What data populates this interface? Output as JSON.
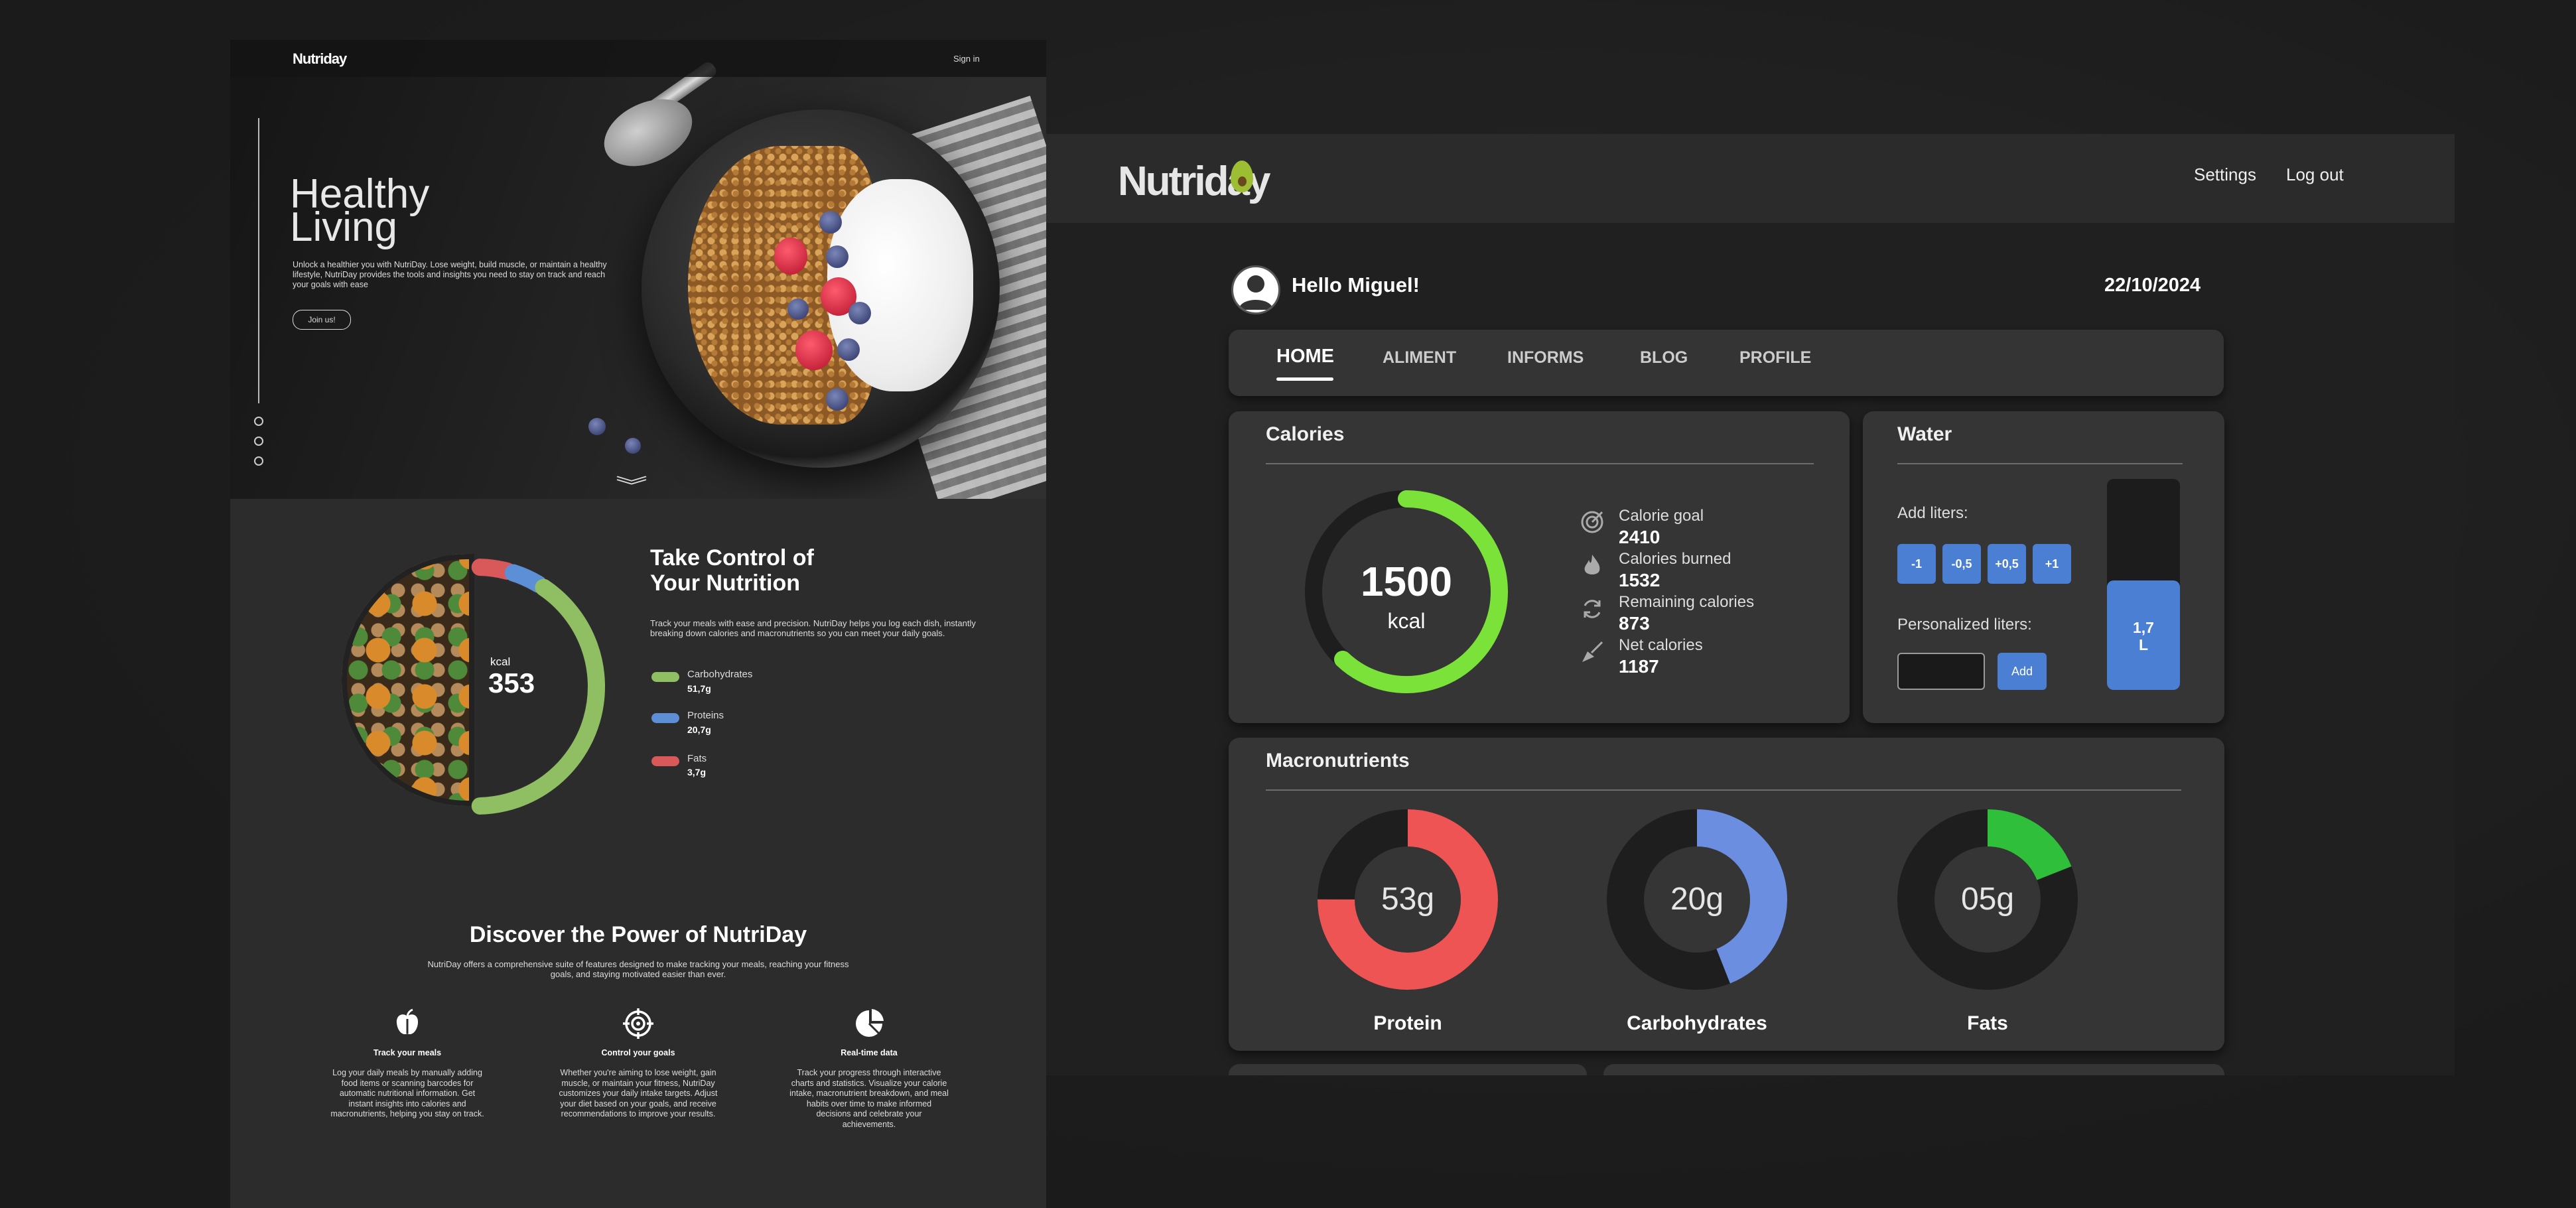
{
  "landing": {
    "nav": {
      "logo": "Nutriday",
      "signin": "Sign in"
    },
    "hero": {
      "title_line1": "Healthy",
      "title_line2": "Living",
      "text": "Unlock a healthier you with NutriDay. Lose weight, build muscle, or maintain a healthy lifestyle, NutriDay provides the tools and insights you need to stay on track and reach your goals with ease",
      "cta": "Join us!",
      "scroll_icon": "chevron-down-icon"
    },
    "nutrition": {
      "title_line1": "Take Control of",
      "title_line2": "Your Nutrition",
      "text": "Track your meals with ease and precision. NutriDay helps you log each dish, instantly breaking down calories and macronutrients so you can meet your daily goals.",
      "kcal_label": "kcal",
      "kcal_value": "353",
      "legend": [
        {
          "name": "Carbohydrates",
          "value": "51,7g",
          "color": "#8fbf62"
        },
        {
          "name": "Proteins",
          "value": "20,7g",
          "color": "#5d8fd6"
        },
        {
          "name": "Fats",
          "value": "3,7g",
          "color": "#d9585a"
        }
      ],
      "ring_fractions": {
        "red": 0.09,
        "blue": 0.09,
        "green": 0.82
      }
    },
    "discover": {
      "title": "Discover the Power of NutriDay",
      "text": "NutriDay offers a comprehensive suite of features designed to make tracking your meals, reaching your fitness goals, and staying motivated easier than ever.",
      "features": [
        {
          "icon": "apple-icon",
          "title": "Track your meals",
          "text": "Log your daily meals by manually adding food items or scanning barcodes for automatic nutritional information. Get instant insights into calories and macronutrients, helping you stay on track."
        },
        {
          "icon": "target-icon",
          "title": "Control your goals",
          "text": "Whether you're aiming to lose weight, gain muscle, or maintain your fitness, NutriDay customizes your daily intake targets. Adjust your diet based on your goals, and receive recommendations to improve your results."
        },
        {
          "icon": "pie-chart-icon",
          "title": "Real-time data",
          "text": "Track your progress through interactive charts and statistics. Visualize your calorie intake, macronutrient breakdown, and meal habits over time to make informed decisions and celebrate your achievements."
        }
      ]
    }
  },
  "dashboard": {
    "logo": "Nutriday",
    "nav": {
      "settings": "Settings",
      "logout": "Log out"
    },
    "greeting": "Hello Miguel!",
    "date": "22/10/2024",
    "tabs": [
      "HOME",
      "ALIMENT",
      "INFORMS",
      "BLOG",
      "PROFILE"
    ],
    "calories": {
      "title": "Calories",
      "center_value": "1500",
      "center_unit": "kcal",
      "progress_fraction": 0.62,
      "stats": [
        {
          "icon": "target-icon",
          "label": "Calorie goal",
          "value": "2410"
        },
        {
          "icon": "flame-icon",
          "label": "Calories burned",
          "value": "1532"
        },
        {
          "icon": "refresh-icon",
          "label": "Remaining calories",
          "value": "873"
        },
        {
          "icon": "broom-icon",
          "label": "Net calories",
          "value": "1187"
        }
      ]
    },
    "water": {
      "title": "Water",
      "add_label": "Add liters:",
      "buttons": [
        "-1",
        "-0,5",
        "+0,5",
        "+1"
      ],
      "personalized_label": "Personalized liters:",
      "input_value": "",
      "add_button": "Add",
      "bottle_line1": "1,7",
      "bottle_line2": "L",
      "fill_fraction": 0.52
    },
    "macros": {
      "title": "Macronutrients",
      "items": [
        {
          "value": "53g",
          "label": "Protein",
          "fraction": 0.75,
          "color": "#ef5454"
        },
        {
          "value": "20g",
          "label": "Carbohydrates",
          "fraction": 0.44,
          "color": "#6b8ee0"
        },
        {
          "value": "05g",
          "label": "Fats",
          "fraction": 0.19,
          "color": "#2fbf3a"
        }
      ]
    },
    "colors": {
      "accent_blue": "#4a7fd4",
      "calorie_green": "#7be23a"
    }
  }
}
